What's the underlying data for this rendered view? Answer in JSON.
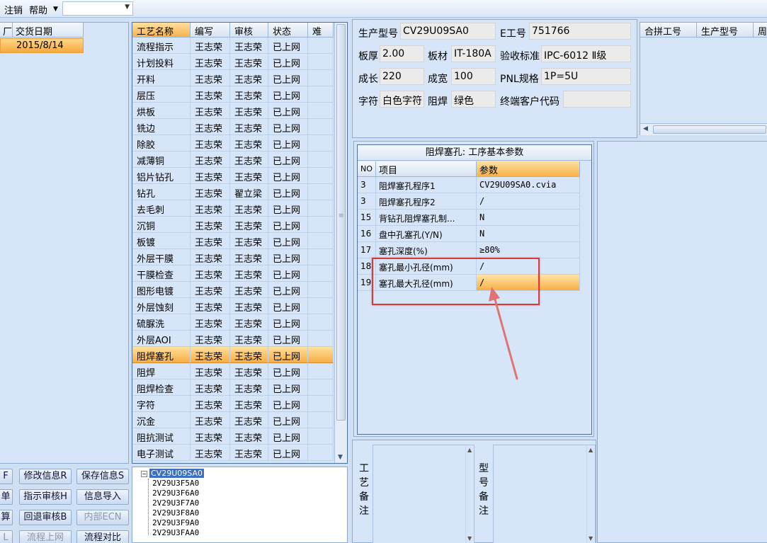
{
  "menu": {
    "items": [
      "注销",
      "帮助"
    ],
    "dropdown_value": ""
  },
  "left": {
    "headers": [
      "厂",
      "交货日期"
    ],
    "row_date": "2015/8/14",
    "buttons": [
      {
        "label": "F",
        "enabled": true
      },
      {
        "label": "修改信息R",
        "enabled": true
      },
      {
        "label": "保存信息S",
        "enabled": true
      },
      {
        "label": "单",
        "enabled": true
      },
      {
        "label": "指示审核H",
        "enabled": true
      },
      {
        "label": "信息导入",
        "enabled": true
      },
      {
        "label": "算",
        "enabled": true
      },
      {
        "label": "回退审核B",
        "enabled": true
      },
      {
        "label": "内部ECN",
        "enabled": false
      },
      {
        "label": "L",
        "enabled": false
      },
      {
        "label": "流程上网",
        "enabled": false
      },
      {
        "label": "流程对比",
        "enabled": true
      }
    ]
  },
  "process_grid": {
    "headers": [
      "工艺名称",
      "编写",
      "审核",
      "状态",
      "难度"
    ],
    "rows": [
      [
        "流程指示",
        "王志荣",
        "王志荣",
        "已上网"
      ],
      [
        "计划投料",
        "王志荣",
        "王志荣",
        "已上网"
      ],
      [
        "开料",
        "王志荣",
        "王志荣",
        "已上网"
      ],
      [
        "层压",
        "王志荣",
        "王志荣",
        "已上网"
      ],
      [
        "烘板",
        "王志荣",
        "王志荣",
        "已上网"
      ],
      [
        "铣边",
        "王志荣",
        "王志荣",
        "已上网"
      ],
      [
        "除胶",
        "王志荣",
        "王志荣",
        "已上网"
      ],
      [
        "减薄铜",
        "王志荣",
        "王志荣",
        "已上网"
      ],
      [
        "铝片钻孔",
        "王志荣",
        "王志荣",
        "已上网"
      ],
      [
        "钻孔",
        "王志荣",
        "翟立梁",
        "已上网"
      ],
      [
        "去毛刺",
        "王志荣",
        "王志荣",
        "已上网"
      ],
      [
        "沉铜",
        "王志荣",
        "王志荣",
        "已上网"
      ],
      [
        "板镀",
        "王志荣",
        "王志荣",
        "已上网"
      ],
      [
        "外层干膜",
        "王志荣",
        "王志荣",
        "已上网"
      ],
      [
        "干膜检查",
        "王志荣",
        "王志荣",
        "已上网"
      ],
      [
        "图形电镀",
        "王志荣",
        "王志荣",
        "已上网"
      ],
      [
        "外层蚀刻",
        "王志荣",
        "王志荣",
        "已上网"
      ],
      [
        "硫脲洗",
        "王志荣",
        "王志荣",
        "已上网"
      ],
      [
        "外层AOI",
        "王志荣",
        "王志荣",
        "已上网"
      ],
      [
        "阻焊塞孔",
        "王志荣",
        "王志荣",
        "已上网"
      ],
      [
        "阻焊",
        "王志荣",
        "王志荣",
        "已上网"
      ],
      [
        "阻焊检查",
        "王志荣",
        "王志荣",
        "已上网"
      ],
      [
        "字符",
        "王志荣",
        "王志荣",
        "已上网"
      ],
      [
        "沉金",
        "王志荣",
        "王志荣",
        "已上网"
      ],
      [
        "阻抗测试",
        "王志荣",
        "王志荣",
        "已上网"
      ],
      [
        "电子测试",
        "王志荣",
        "王志荣",
        "已上网"
      ]
    ],
    "selected_index": 19
  },
  "tree": {
    "root": "CV29U09SA0",
    "root_toggle": "−",
    "children": [
      "2V29U3F5A0",
      "2V29U3F6A0",
      "2V29U3F7A0",
      "2V29U3F8A0",
      "2V29U3F9A0",
      "2V29U3FAA0"
    ]
  },
  "info": {
    "model_label": "生产型号",
    "model": "CV29U09SA0",
    "eng_label": "E工号",
    "eng_no": "751766",
    "thickness_label": "板厚",
    "thickness": "2.00",
    "material_label": "板材",
    "material": "IT-180A",
    "standard_label": "验收标准",
    "standard": "IPC-6012 Ⅱ级",
    "length_label": "成长",
    "length": "220",
    "width_label": "成宽",
    "width": "100",
    "pnl_label": "PNL规格",
    "pnl": "1P=5U",
    "char_label": "字符",
    "char": "白色字符",
    "mask_label": "阻焊",
    "mask": "绿色",
    "customer_label": "终端客户代码",
    "customer": ""
  },
  "merge_table": {
    "headers": [
      "合拼工号",
      "生产型号",
      "周"
    ]
  },
  "params": {
    "title": "阻焊塞孔: 工序基本参数",
    "headers": [
      "NO",
      "项目",
      "参数"
    ],
    "rows": [
      [
        "3",
        "阻焊塞孔程序1",
        "CV29U09SA0.cvia"
      ],
      [
        "3",
        "阻焊塞孔程序2",
        "/"
      ],
      [
        "15",
        "背钻孔阻焊塞孔制...",
        "N"
      ],
      [
        "16",
        "盘中孔塞孔(Y/N)",
        "N"
      ],
      [
        "17",
        "塞孔深度(%)",
        "≥80%"
      ],
      [
        "18",
        "塞孔最小孔径(mm)",
        "/"
      ],
      [
        "19",
        "塞孔最大孔径(mm)",
        "/"
      ]
    ],
    "selected_index": 6
  },
  "remarks": {
    "process_label": "工艺备注",
    "model_label": "型号备注"
  },
  "colors": {
    "selection": "#f7ae45",
    "highlight_box": "#d93a3a",
    "arrow": "#e07474"
  }
}
